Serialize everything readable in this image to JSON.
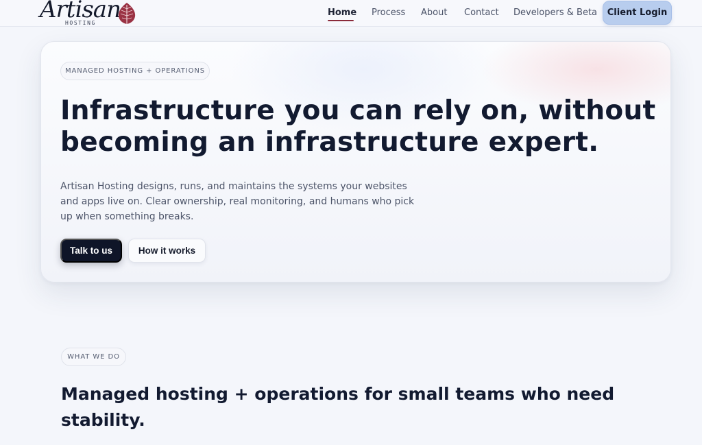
{
  "brand": {
    "name": "Artisan",
    "subtitle": "HOSTING",
    "accent_color": "#8a2a3a",
    "logo_icon": "leaf-icon"
  },
  "nav": {
    "items": [
      {
        "label": "Home",
        "active": true
      },
      {
        "label": "Process",
        "active": false
      },
      {
        "label": "About",
        "active": false
      },
      {
        "label": "Contact",
        "active": false
      },
      {
        "label": "Developers & Beta",
        "active": false
      }
    ],
    "client_login": "Client Login"
  },
  "hero": {
    "eyebrow": "MANAGED HOSTING + OPERATIONS",
    "title": "Infrastructure you can rely on, without becoming an infrastructure expert.",
    "description": "Artisan Hosting designs, runs, and maintains the systems your websites and apps live on. Clear ownership, real monitoring, and humans who pick up when something breaks.",
    "primary_cta": "Talk to us",
    "secondary_cta": "How it works"
  },
  "what_we_do": {
    "eyebrow": "WHAT WE DO",
    "title": "Managed hosting + operations for small teams who need stability."
  },
  "colors": {
    "primary_button": "#0f1528",
    "client_login_bg": "#b8cdee",
    "page_bg": "#f4f6fb",
    "text_dark": "#121a30"
  }
}
